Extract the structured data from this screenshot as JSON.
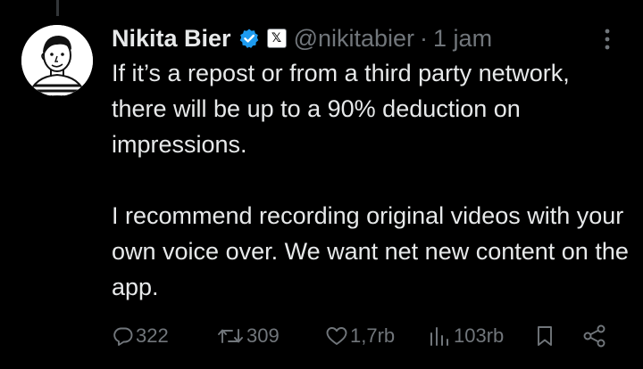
{
  "post": {
    "author_name": "Nikita Bier",
    "handle": "@nikitabier",
    "separator": "·",
    "time": "1 jam",
    "affiliation_glyph": "𝕏",
    "text_paragraph_1": "If it’s a repost or from a third party network, there will be up to a 90% deduction on impressions.",
    "text_paragraph_2": "I recommend recording original videos with your own voice over. We want net new content on the app."
  },
  "actions": {
    "replies": "322",
    "reposts": "309",
    "likes": "1,7rb",
    "views": "103rb"
  },
  "icons": {
    "verified": "verified-badge-icon",
    "affiliation": "x-logo-icon",
    "more": "more-icon",
    "reply": "reply-icon",
    "repost": "repost-icon",
    "like": "heart-icon",
    "views": "views-icon",
    "bookmark": "bookmark-icon",
    "share": "share-icon"
  },
  "colors": {
    "background": "#000000",
    "text_primary": "#e7e9ea",
    "text_secondary": "#71767b",
    "verified_blue": "#1d9bf0"
  }
}
